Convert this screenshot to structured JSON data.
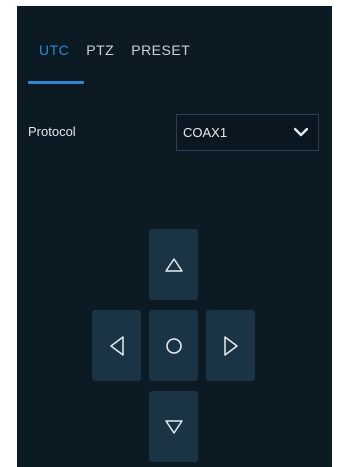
{
  "tabs": [
    {
      "label": "UTC",
      "active": true
    },
    {
      "label": "PTZ",
      "active": false
    },
    {
      "label": "PRESET",
      "active": false
    }
  ],
  "protocol": {
    "label": "Protocol",
    "value": "COAX1"
  },
  "colors": {
    "panel_bg": "#0c1a24",
    "accent": "#2f86d6",
    "button_bg": "#1a3446",
    "icon_stroke": "#e6ebef"
  },
  "controls": {
    "up_icon": "triangle-up-icon",
    "left_icon": "triangle-left-icon",
    "center_icon": "circle-icon",
    "right_icon": "triangle-right-icon",
    "down_icon": "triangle-down-icon"
  }
}
